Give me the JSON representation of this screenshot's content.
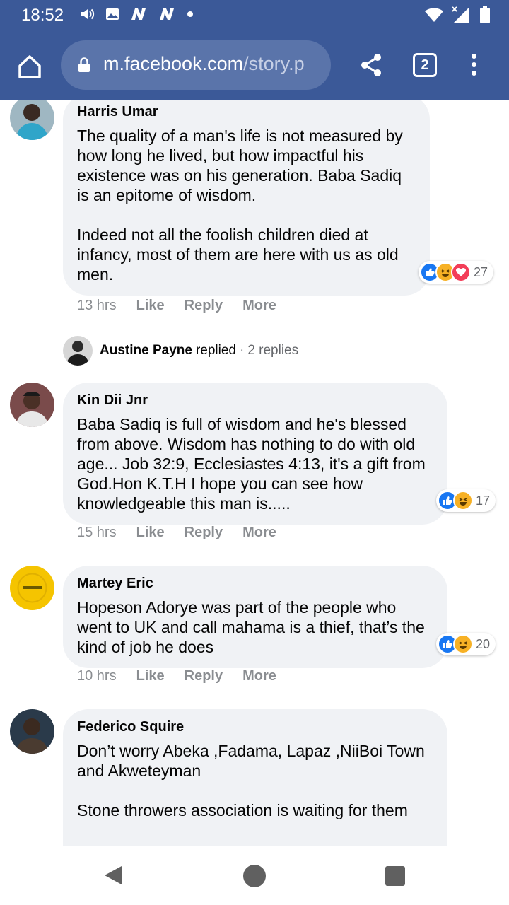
{
  "status_bar": {
    "time": "18:52",
    "left_icons": [
      "volume-icon",
      "image-icon",
      "n-icon",
      "n-icon",
      "dot-icon"
    ],
    "right_icons": [
      "wifi-icon",
      "signal-icon",
      "battery-icon"
    ]
  },
  "browser": {
    "url_host": "m.facebook.com",
    "url_path": "/story.p",
    "tab_count": "2"
  },
  "comments": [
    {
      "author": "Harris Umar",
      "text": "The quality of a man's life is not measured by how long he lived, but how impactful his existence was on his generation. Baba Sadiq is an epitome of wisdom.\n\nIndeed not all the foolish children died at infancy, most of them are here with us as old men.",
      "reactions": [
        "like",
        "haha",
        "love"
      ],
      "reaction_count": "27",
      "time": "13 hrs",
      "like": "Like",
      "reply": "Reply",
      "more": "More"
    },
    {
      "author": "Kin Dii Jnr",
      "text": "Baba Sadiq is full of wisdom and he's blessed from above. Wisdom has nothing to do with old age... Job 32:9, Ecclesiastes 4:13, it's a gift from God.Hon K.T.H I hope you can see how knowledgeable this man is.....",
      "reactions": [
        "like",
        "haha"
      ],
      "reaction_count": "17",
      "time": "15 hrs",
      "like": "Like",
      "reply": "Reply",
      "more": "More"
    },
    {
      "author": "Martey Eric",
      "text": "Hopeson Adorye was part of the people who went to UK and call mahama is a thief, that’s the kind of job he does",
      "reactions": [
        "like",
        "haha"
      ],
      "reaction_count": "20",
      "time": "10 hrs",
      "like": "Like",
      "reply": "Reply",
      "more": "More"
    },
    {
      "author": "Federico Squire",
      "text": "Don’t worry Abeka ,Fadama, Lapaz ,NiiBoi Town and Akweteyman\n\nStone throwers association is waiting for them"
    }
  ],
  "reply_summary": {
    "name": "Austine Payne",
    "verb": "replied",
    "dot": "·",
    "count": "2 replies"
  },
  "colors": {
    "header": "#3b5998",
    "bubble": "#f0f2f5",
    "like": "#1877f2",
    "haha": "#f7b125",
    "love": "#f33e58",
    "meta": "#8a8d91"
  }
}
